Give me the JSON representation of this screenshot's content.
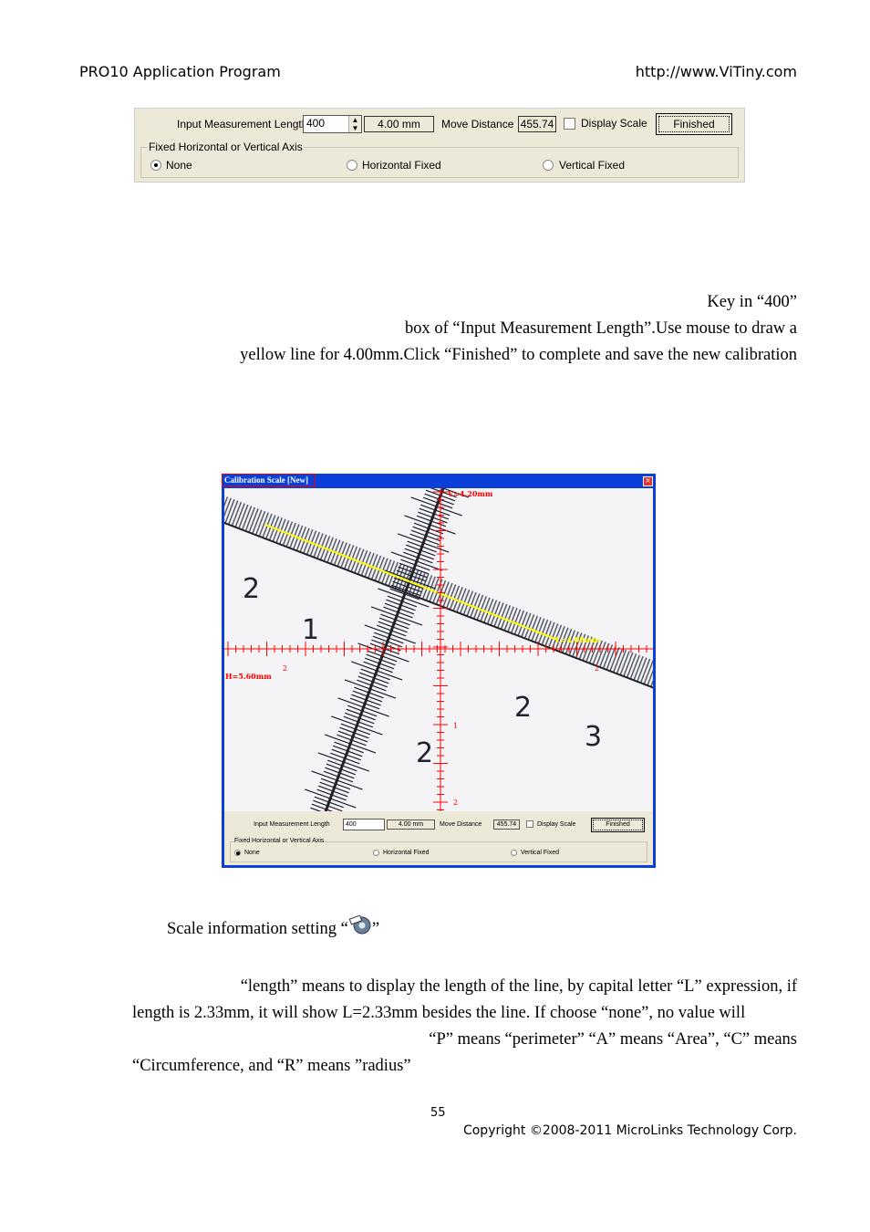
{
  "header": {
    "left": "PRO10 Application Program",
    "right": "http://www.ViTiny.com"
  },
  "toolbar": {
    "input_label": "Input Measurement Length",
    "input_value": "400",
    "mm_value": "4.00 mm",
    "move_label": "Move Distance",
    "move_value": "455.74",
    "display_scale": "Display Scale",
    "finished": "Finished",
    "group_label": "Fixed Horizontal or Vertical Axis",
    "radio_none": "None",
    "radio_horizontal": "Horizontal Fixed",
    "radio_vertical": "Vertical Fixed"
  },
  "para1": {
    "line1": "Key in “400”",
    "line2": "box  of  “Input  Measurement  Length”.Use  mouse  to  draw  a",
    "line3": "yellow line for 4.00mm.Click “Finished” to complete and save the new calibration"
  },
  "window": {
    "title": "Calibration Scale [New]",
    "v_label": "V=4.20mm",
    "h_label": "H=5.60mm",
    "l_label": "L=4.00mm",
    "axis_1": "1",
    "axis_2": "2",
    "colors": {
      "title_bar": "#0a3fd8",
      "overlay": "#ff0000",
      "line": "#ffff00"
    }
  },
  "para2": {
    "text": "Scale information setting “",
    "close": "”",
    "icon": "ruler-gear-icon"
  },
  "para3": {
    "line1": "“length”  means  to  display  the  length  of  the  line,  by  capital  letter  “L”  expression,  if",
    "line2": "length  is  2.33mm,  it  will  show  L=2.33mm  besides  the  line.  If  choose  “none”,  no  value  will",
    "line3": "“P”  means  “perimeter”   “A”  means  “Area”,  “C”  means",
    "line4": "“Circumference, and “R” means ”radius”"
  },
  "footer": {
    "page": "55",
    "copyright": "Copyright ©2008-2011 MicroLinks Technology Corp."
  }
}
